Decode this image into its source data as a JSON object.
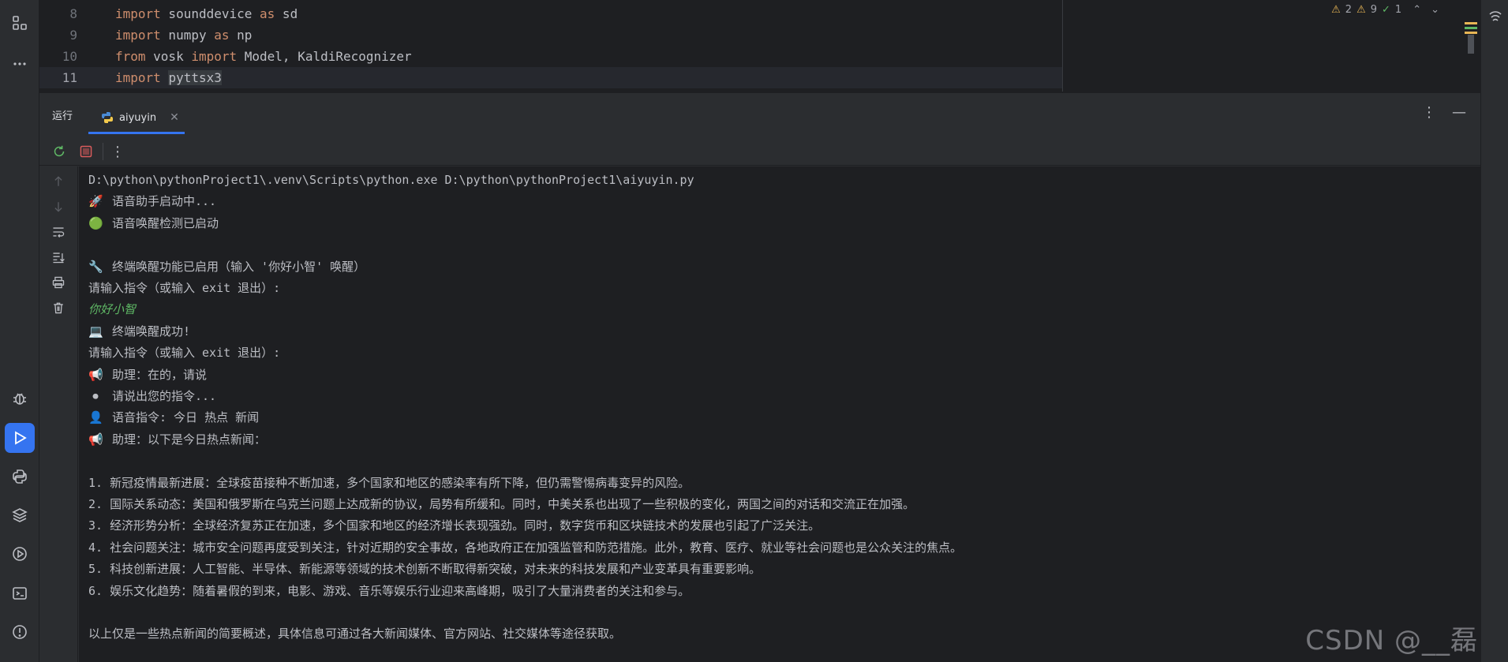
{
  "editor": {
    "lines": [
      {
        "num": "8",
        "parts": [
          {
            "t": "import",
            "c": "kw"
          },
          {
            "t": " sounddevice ",
            "c": "plain"
          },
          {
            "t": "as",
            "c": "kw"
          },
          {
            "t": " sd",
            "c": "plain"
          }
        ]
      },
      {
        "num": "9",
        "parts": [
          {
            "t": "import",
            "c": "kw"
          },
          {
            "t": " numpy ",
            "c": "plain"
          },
          {
            "t": "as",
            "c": "kw"
          },
          {
            "t": " np",
            "c": "plain"
          }
        ]
      },
      {
        "num": "10",
        "parts": [
          {
            "t": "from",
            "c": "kw"
          },
          {
            "t": " vosk ",
            "c": "plain"
          },
          {
            "t": "import",
            "c": "kw"
          },
          {
            "t": " Model, KaldiRecognizer",
            "c": "plain"
          }
        ]
      },
      {
        "num": "11",
        "parts": [
          {
            "t": "import",
            "c": "kw"
          },
          {
            "t": " ",
            "c": "plain"
          },
          {
            "t": "pyttsx3",
            "c": "plain hl-word"
          }
        ]
      }
    ],
    "current_line": "11",
    "inspections": {
      "warnings_a": "2",
      "warnings_b": "9",
      "ok": "1"
    }
  },
  "toolwindow": {
    "title": "运行",
    "tab_label": "aiyuyin",
    "tab_close": "✕"
  },
  "console": {
    "lines": [
      {
        "icon": "",
        "text": "D:\\python\\pythonProject1\\.venv\\Scripts\\python.exe D:\\python\\pythonProject1\\aiyuyin.py",
        "type": "out"
      },
      {
        "icon": "🚀",
        "text": "语音助手启动中...",
        "type": "out"
      },
      {
        "icon": "🟢",
        "text": "语音唤醒检测已启动",
        "type": "out"
      },
      {
        "icon": "",
        "text": "",
        "type": "out"
      },
      {
        "icon": "🔧",
        "text": "终端唤醒功能已启用（输入 '你好小智' 唤醒）",
        "type": "out"
      },
      {
        "icon": "",
        "text": "请输入指令（或输入 exit 退出）:",
        "type": "out"
      },
      {
        "icon": "",
        "text": "你好小智",
        "type": "input"
      },
      {
        "icon": "💻",
        "text": "终端唤醒成功!",
        "type": "out"
      },
      {
        "icon": "",
        "text": "请输入指令（或输入 exit 退出）:",
        "type": "out"
      },
      {
        "icon": "📢",
        "text": "助理：在的，请说",
        "type": "out"
      },
      {
        "icon": "⏺",
        "text": "请说出您的指令...",
        "type": "out"
      },
      {
        "icon": "👤",
        "text": "语音指令: 今日 热点 新闻",
        "type": "out"
      },
      {
        "icon": "📢",
        "text": "助理：以下是今日热点新闻：",
        "type": "out"
      },
      {
        "icon": "",
        "text": "",
        "type": "out"
      },
      {
        "icon": "",
        "text": "1. 新冠疫情最新进展：全球疫苗接种不断加速，多个国家和地区的感染率有所下降，但仍需警惕病毒变异的风险。",
        "type": "out"
      },
      {
        "icon": "",
        "text": "2. 国际关系动态：美国和俄罗斯在乌克兰问题上达成新的协议，局势有所缓和。同时，中美关系也出现了一些积极的变化，两国之间的对话和交流正在加强。",
        "type": "out"
      },
      {
        "icon": "",
        "text": "3. 经济形势分析：全球经济复苏正在加速，多个国家和地区的经济增长表现强劲。同时，数字货币和区块链技术的发展也引起了广泛关注。",
        "type": "out"
      },
      {
        "icon": "",
        "text": "4. 社会问题关注：城市安全问题再度受到关注，针对近期的安全事故，各地政府正在加强监管和防范措施。此外，教育、医疗、就业等社会问题也是公众关注的焦点。",
        "type": "out"
      },
      {
        "icon": "",
        "text": "5. 科技创新进展：人工智能、半导体、新能源等领域的技术创新不断取得新突破，对未来的科技发展和产业变革具有重要影响。",
        "type": "out"
      },
      {
        "icon": "",
        "text": "6. 娱乐文化趋势：随着暑假的到来，电影、游戏、音乐等娱乐行业迎来高峰期，吸引了大量消费者的关注和参与。",
        "type": "out"
      },
      {
        "icon": "",
        "text": "",
        "type": "out"
      },
      {
        "icon": "",
        "text": "以上仅是一些热点新闻的简要概述，具体信息可通过各大新闻媒体、官方网站、社交媒体等途径获取。",
        "type": "out"
      }
    ]
  },
  "watermark": "CSDN @__磊",
  "colors": {
    "accent": "#3574f0",
    "keyword": "#cf8e6d",
    "input_text": "#5fb865",
    "stop_button": "#db5c5c"
  }
}
